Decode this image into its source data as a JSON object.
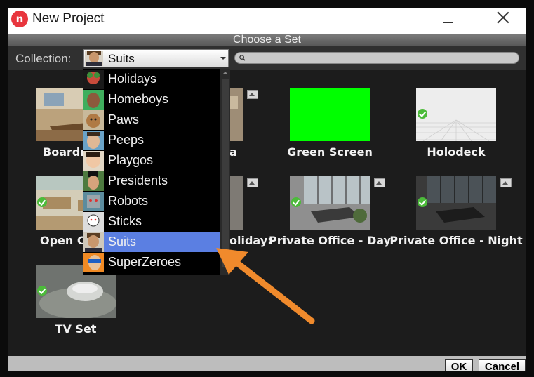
{
  "window": {
    "title": "New Project",
    "subtitle": "Choose a Set",
    "logo_letter": "n",
    "controls": [
      "minimize-icon",
      "maximize-icon",
      "close-icon"
    ]
  },
  "toolbar": {
    "collection_label": "Collection:",
    "collection_value": "Suits",
    "search_placeholder": "",
    "icons": [
      "chevron-down-icon",
      "search-icon"
    ]
  },
  "sets": [
    {
      "label": "Boardroom",
      "installed": false
    },
    {
      "label": "Café",
      "installed": false
    },
    {
      "label": "Green Screen",
      "installed": false
    },
    {
      "label": "Holodeck",
      "installed": true
    },
    {
      "label": "Open Office",
      "installed": true
    },
    {
      "label": "Holiday!",
      "installed": false
    },
    {
      "label": "Private Office - Day",
      "installed": true
    },
    {
      "label": "Private Office - Night",
      "installed": true
    },
    {
      "label": "TV Set",
      "installed": true
    }
  ],
  "visible_labels": {
    "boardroom": "Boardr",
    "cafe": "a",
    "open_office": "Open C",
    "holiday": "oliday:"
  },
  "dropdown": {
    "items": [
      {
        "label": "Holidays",
        "selected": false
      },
      {
        "label": "Homeboys",
        "selected": false
      },
      {
        "label": "Paws",
        "selected": false
      },
      {
        "label": "Peeps",
        "selected": false
      },
      {
        "label": "Playgos",
        "selected": false
      },
      {
        "label": "Presidents",
        "selected": false
      },
      {
        "label": "Robots",
        "selected": false
      },
      {
        "label": "Sticks",
        "selected": false
      },
      {
        "label": "Suits",
        "selected": true
      },
      {
        "label": "SuperZeroes",
        "selected": false
      }
    ]
  },
  "footer": {
    "ok_label": "OK",
    "cancel_label": "Cancel"
  },
  "colors": {
    "accent_selection": "#5b7fe2",
    "annotation_arrow": "#f08a2c",
    "green_screen": "#00ff00",
    "logo": "#e8363e"
  }
}
